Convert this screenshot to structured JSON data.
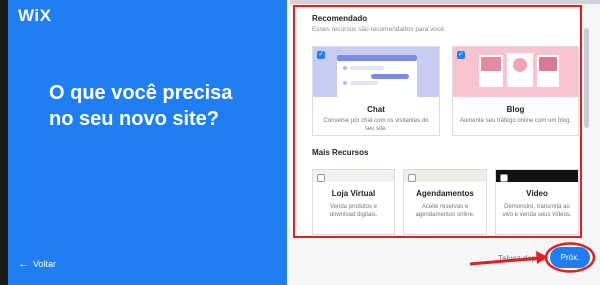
{
  "brand": {
    "logo": "WiX"
  },
  "left": {
    "question": "O que você precisa no seu novo site?",
    "back_label": "Voltar",
    "back_icon": "arrow-left-icon"
  },
  "recommended": {
    "title": "Recomendado",
    "subtitle": "Esses recursos são recomendados para você.",
    "cards": [
      {
        "title": "Chat",
        "description": "Converse por chat com os visitantes do seu site.",
        "checked": true
      },
      {
        "title": "Blog",
        "description": "Aumente seu tráfego online com um blog.",
        "checked": true
      }
    ]
  },
  "more": {
    "title": "Mais Recursos",
    "cards": [
      {
        "title": "Loja Virtual",
        "description": "Venda produtos e download digitais.",
        "checked": false
      },
      {
        "title": "Agendamentos",
        "description": "Aceite reservas e agendamentos online.",
        "checked": false
      },
      {
        "title": "Vídeo",
        "description": "Demonstre, transmita ao vivo e venda seus vídeos.",
        "checked": false
      }
    ]
  },
  "footer": {
    "skip_label": "Talvez depois",
    "next_label": "Próx."
  },
  "colors": {
    "accent": "#1e7ef2",
    "annotation": "#e02020",
    "chat_bg": "#c7cdf2",
    "blog_bg": "#f8c4cf"
  }
}
